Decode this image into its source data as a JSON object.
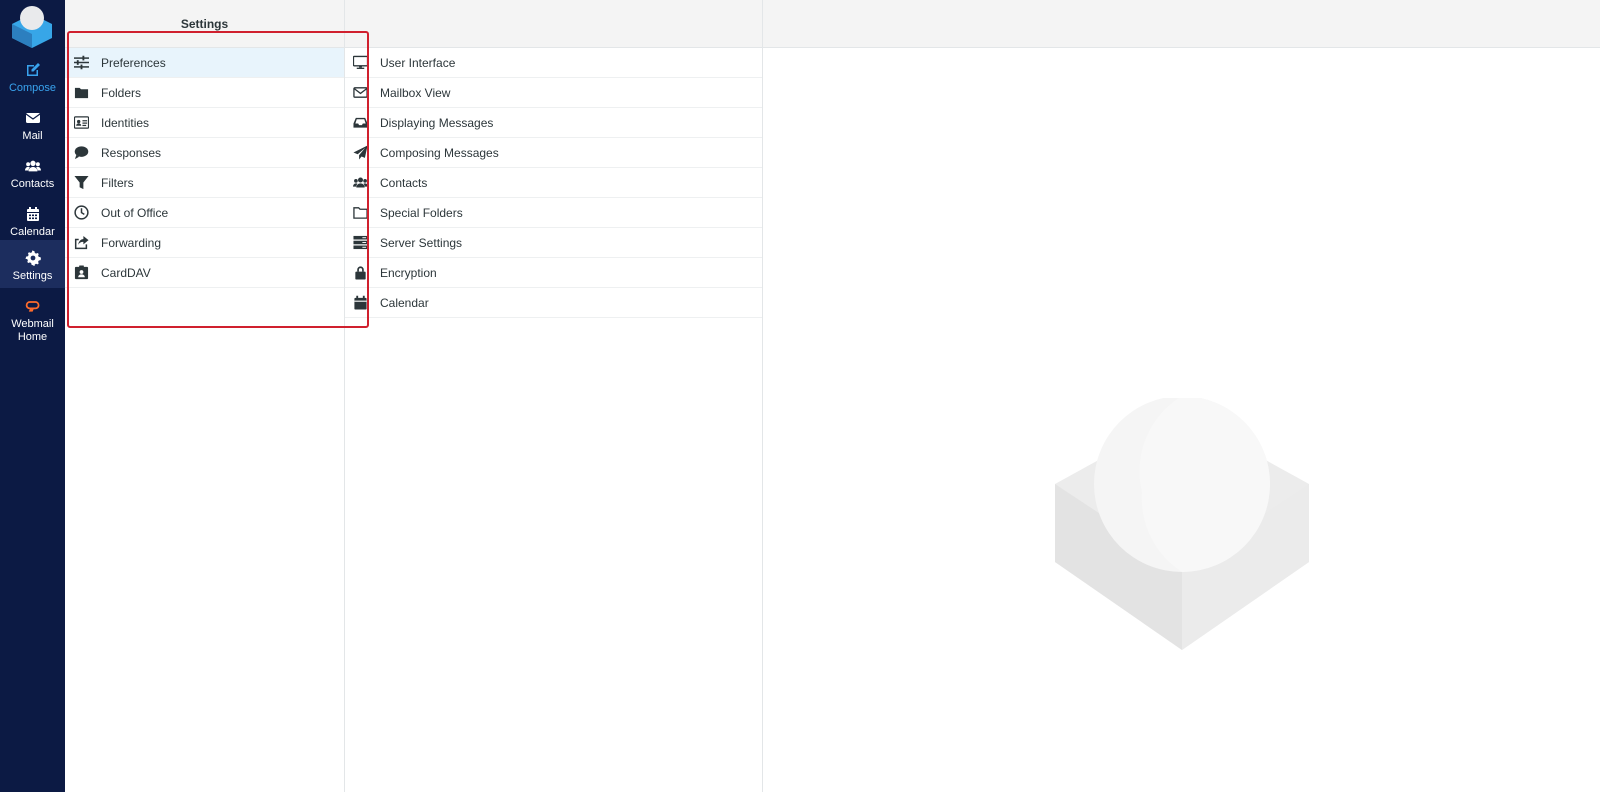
{
  "nav": {
    "items": [
      {
        "label": "Compose",
        "icon": "compose-icon"
      },
      {
        "label": "Mail",
        "icon": "envelope-icon"
      },
      {
        "label": "Contacts",
        "icon": "users-icon"
      },
      {
        "label": "Calendar",
        "icon": "calendar-icon"
      },
      {
        "label": "Settings",
        "icon": "gear-icon"
      },
      {
        "label_line1": "Webmail",
        "label_line2": "Home",
        "icon": "cpanel-icon"
      }
    ],
    "active": "Settings"
  },
  "settings": {
    "header": "Settings",
    "items": [
      {
        "label": "Preferences",
        "icon": "sliders-icon"
      },
      {
        "label": "Folders",
        "icon": "folder-icon"
      },
      {
        "label": "Identities",
        "icon": "id-card-icon"
      },
      {
        "label": "Responses",
        "icon": "comment-icon"
      },
      {
        "label": "Filters",
        "icon": "filter-icon"
      },
      {
        "label": "Out of Office",
        "icon": "clock-icon"
      },
      {
        "label": "Forwarding",
        "icon": "share-icon"
      },
      {
        "label": "CardDAV",
        "icon": "contact-card-icon"
      }
    ],
    "selected": "Preferences"
  },
  "sections": {
    "items": [
      {
        "label": "User Interface",
        "icon": "monitor-icon"
      },
      {
        "label": "Mailbox View",
        "icon": "envelope-open-icon"
      },
      {
        "label": "Displaying Messages",
        "icon": "inbox-icon"
      },
      {
        "label": "Composing Messages",
        "icon": "paper-plane-icon"
      },
      {
        "label": "Contacts",
        "icon": "users-icon"
      },
      {
        "label": "Special Folders",
        "icon": "folder-outline-icon"
      },
      {
        "label": "Server Settings",
        "icon": "server-icon"
      },
      {
        "label": "Encryption",
        "icon": "lock-icon"
      },
      {
        "label": "Calendar",
        "icon": "calendar-icon"
      }
    ]
  },
  "colors": {
    "nav_bg": "#0c1a44",
    "nav_active": "#1c2d5e",
    "accent": "#39a3ee",
    "highlight": "#d0202e"
  }
}
